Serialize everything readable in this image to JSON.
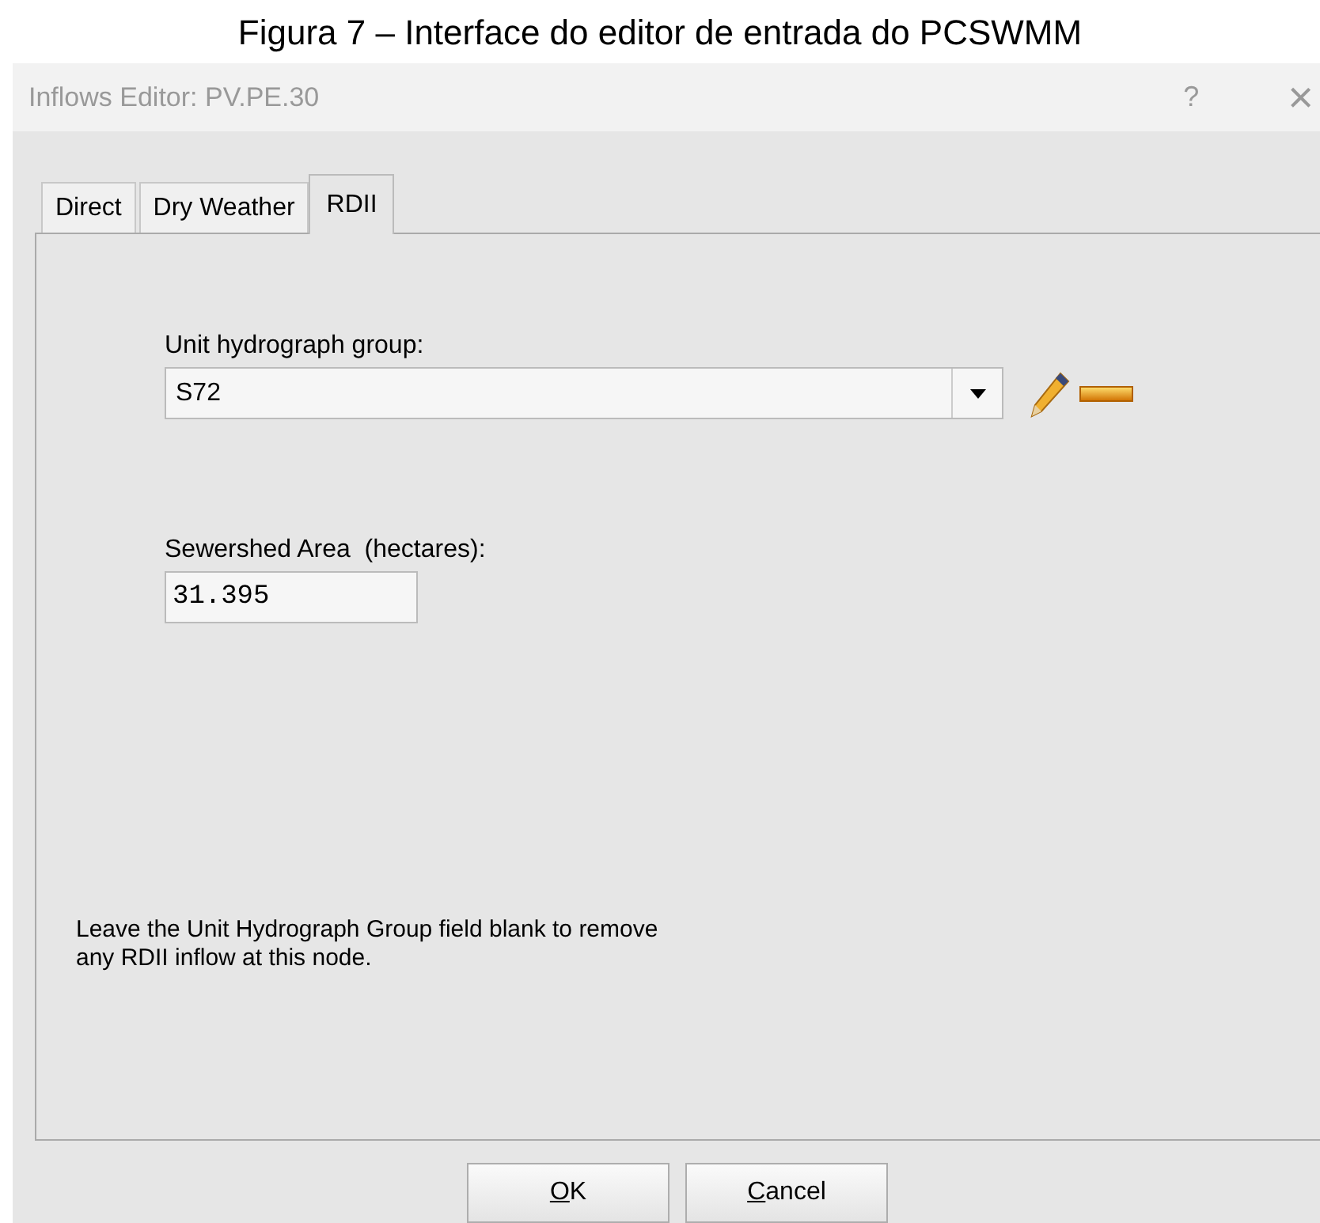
{
  "caption": "Figura 7 – Interface do editor de entrada do PCSWMM",
  "window": {
    "title": "Inflows Editor: PV.PE.30",
    "help": "?",
    "close": "×"
  },
  "tabs": [
    {
      "label": "Direct",
      "selected": false
    },
    {
      "label": "Dry Weather",
      "selected": false
    },
    {
      "label": "RDII",
      "selected": true
    }
  ],
  "unit_hydrograph_group": {
    "label": "Unit hydrograph group:",
    "value": "S72"
  },
  "sewershed_area": {
    "label": "Sewershed Area  (hectares):",
    "value": "31.395"
  },
  "note": "Leave the Unit Hydrograph Group field blank to remove\nany RDII inflow at this node.",
  "buttons": [
    {
      "label": "OK",
      "access_key_underlined": true
    },
    {
      "label": "Cancel",
      "access_key_underlined": true
    }
  ]
}
